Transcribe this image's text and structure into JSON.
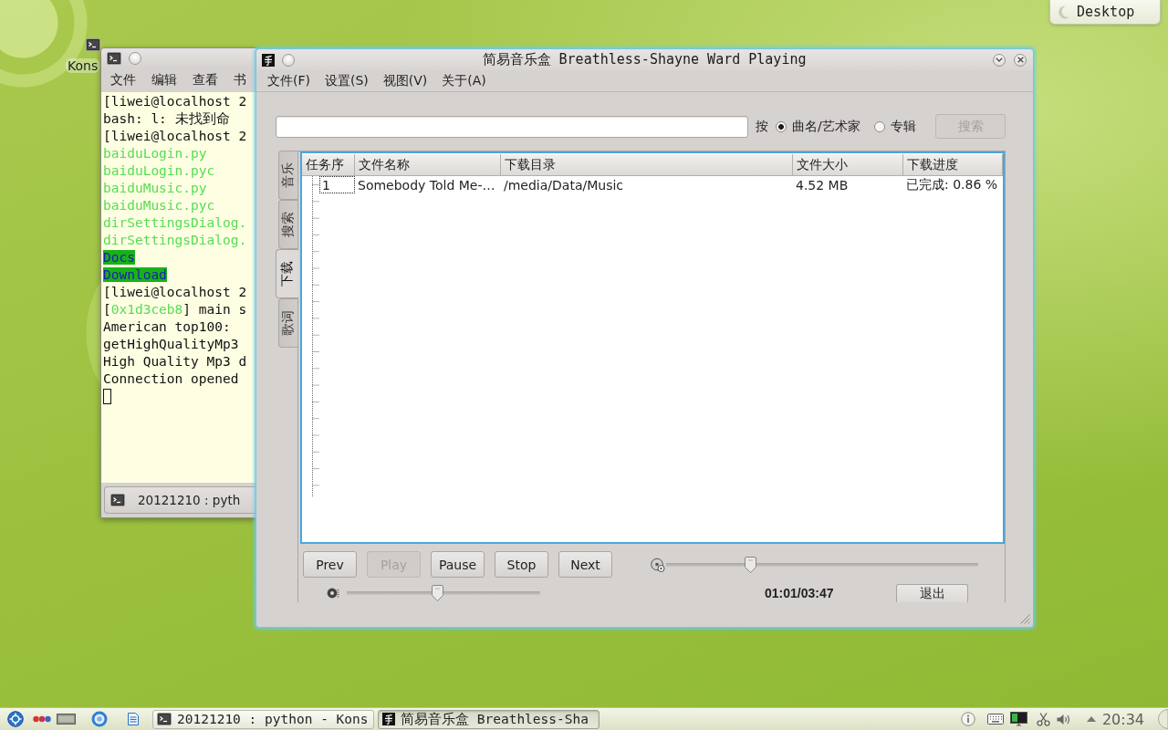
{
  "desktop": {
    "icon": {
      "label": "Kons"
    },
    "widget": {
      "label": "Desktop"
    }
  },
  "terminal": {
    "menu": [
      "文件",
      "编辑",
      "查看",
      "书"
    ],
    "lines": [
      {
        "kind": "text",
        "text": "[liwei@localhost 2"
      },
      {
        "kind": "text",
        "text": "bash: l: 未找到命"
      },
      {
        "kind": "text",
        "text": "[liwei@localhost 2"
      },
      {
        "kind": "highlight",
        "text": "baiduLogin.py"
      },
      {
        "kind": "highlight",
        "text": "baiduLogin.pyc"
      },
      {
        "kind": "highlight",
        "text": "baiduMusic.py"
      },
      {
        "kind": "highlight",
        "text": "baiduMusic.pyc"
      },
      {
        "kind": "highlight",
        "text": "dirSettingsDialog."
      },
      {
        "kind": "highlight",
        "text": "dirSettingsDialog."
      },
      {
        "kind": "dir",
        "text": "Docs"
      },
      {
        "kind": "dir",
        "text": "Download"
      },
      {
        "kind": "text",
        "text": "[liwei@localhost 2"
      },
      {
        "kind": "mixed",
        "segments": [
          {
            "kind": "text",
            "text": "["
          },
          {
            "kind": "highlight",
            "text": "0x1d3ceb8"
          },
          {
            "kind": "text",
            "text": "] main s"
          }
        ]
      },
      {
        "kind": "text",
        "text": "American top100:"
      },
      {
        "kind": "text",
        "text": "getHighQualityMp3"
      },
      {
        "kind": "text",
        "text": "High Quality Mp3 d"
      },
      {
        "kind": "text",
        "text": "Connection opened"
      }
    ],
    "cursor": true,
    "tab": "20121210 : pyth"
  },
  "player": {
    "title": "简易音乐盒 Breathless-Shayne Ward Playing",
    "menu": [
      "文件(F)",
      "设置(S)",
      "视图(V)",
      "关于(A)"
    ],
    "search": {
      "by_label": "按",
      "options": [
        {
          "label": "曲名/艺术家",
          "selected": true
        },
        {
          "label": "专辑",
          "selected": false
        }
      ],
      "button": {
        "label": "搜索",
        "disabled": true
      }
    },
    "tabs": [
      {
        "label": "音乐",
        "selected": false
      },
      {
        "label": "搜索",
        "selected": false
      },
      {
        "label": "下载",
        "selected": true
      },
      {
        "label": "歌词",
        "selected": false
      }
    ],
    "table": {
      "columns": [
        "任务序",
        "文件名称",
        "下载目录",
        "文件大小",
        "下载进度"
      ],
      "rows": [
        {
          "focused": true,
          "cells": [
            "1",
            "Somebody Told Me-…",
            "/media/Data/Music",
            "4.52 MB",
            "已完成: 0.86 %"
          ]
        }
      ]
    },
    "controls": {
      "buttons": [
        {
          "label": "Prev",
          "disabled": false
        },
        {
          "label": "Play",
          "disabled": true
        },
        {
          "label": "Pause",
          "disabled": false
        },
        {
          "label": "Stop",
          "disabled": false
        },
        {
          "label": "Next",
          "disabled": false
        }
      ],
      "seek": {
        "level": 0.27
      },
      "volume": {
        "level": 0.47
      },
      "time": "01:01/03:47",
      "quit": {
        "label": "退出"
      }
    }
  },
  "taskbar": {
    "tasks": [
      {
        "kind": "terminal",
        "label": "20121210 : python - Kons",
        "selected": false
      },
      {
        "kind": "player",
        "label": "简易音乐盒 Breathless-Sha",
        "selected": true
      }
    ],
    "clock": "20:34"
  }
}
